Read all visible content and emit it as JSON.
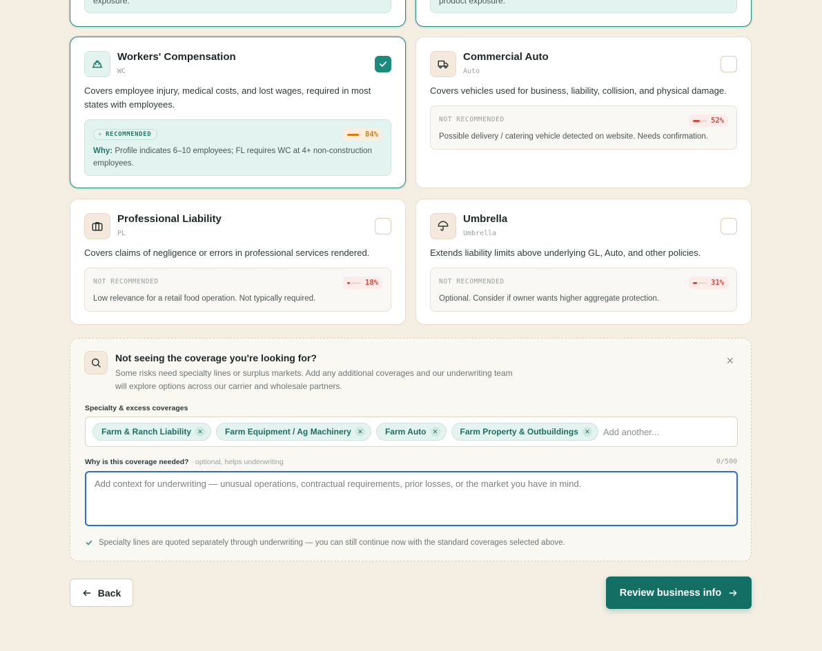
{
  "top_stubs": [
    {
      "text": "exposure."
    },
    {
      "text": "product exposure."
    }
  ],
  "coverages": [
    {
      "title": "Workers' Compensation",
      "code": "WC",
      "icon": "hard-hat-icon",
      "selected": true,
      "description": "Covers employee injury, medical costs, and lost wages, required in most states with employees.",
      "recommendation": {
        "label": "RECOMMENDED",
        "score": "84%",
        "score_fraction": 0.84,
        "why_label": "Why:",
        "text": "Profile indicates 6–10 employees; FL requires WC at 4+ non-construction employees."
      }
    },
    {
      "title": "Commercial Auto",
      "code": "Auto",
      "icon": "truck-icon",
      "selected": false,
      "description": "Covers vehicles used for business, liability, collision, and physical damage.",
      "recommendation": {
        "label": "NOT RECOMMENDED",
        "score": "52%",
        "score_fraction": 0.52,
        "text": "Possible delivery / catering vehicle detected on website. Needs confirmation."
      }
    },
    {
      "title": "Professional Liability",
      "code": "PL",
      "icon": "briefcase-icon",
      "selected": false,
      "description": "Covers claims of negligence or errors in professional services rendered.",
      "recommendation": {
        "label": "NOT RECOMMENDED",
        "score": "18%",
        "score_fraction": 0.18,
        "text": "Low relevance for a retail food operation. Not typically required."
      }
    },
    {
      "title": "Umbrella",
      "code": "Umbrella",
      "icon": "umbrella-icon",
      "selected": false,
      "description": "Extends liability limits above underlying GL, Auto, and other policies.",
      "recommendation": {
        "label": "NOT RECOMMENDED",
        "score": "31%",
        "score_fraction": 0.31,
        "text": "Optional. Consider if owner wants higher aggregate protection."
      }
    }
  ],
  "specialty": {
    "title": "Not seeing the coverage you're looking for?",
    "subtitle": "Some risks need specialty lines or surplus markets. Add any additional coverages and our underwriting team will explore options across our carrier and wholesale partners.",
    "close": "×",
    "tags_label": "Specialty & excess coverages",
    "tags": [
      "Farm & Ranch Liability",
      "Farm Equipment / Ag Machinery",
      "Farm Auto",
      "Farm Property & Outbuildings"
    ],
    "add_placeholder": "Add another...",
    "reason_label": "Why is this coverage needed?",
    "reason_hint": "· optional, helps underwriting",
    "reason_counter": "0/500",
    "reason_placeholder": "Add context for underwriting — unusual operations, contractual requirements, prior losses, or the market you have in mind.",
    "note": "Specialty lines are quoted separately through underwriting — you can still continue now with the standard coverages selected above."
  },
  "footer": {
    "back_label": "Back",
    "next_label": "Review business info"
  },
  "colors": {
    "brand": "#136e63",
    "accent": "#1e8a7c",
    "focus": "#2a6fd6",
    "score_orange": "#d4800f",
    "score_red": "#d7493b"
  }
}
